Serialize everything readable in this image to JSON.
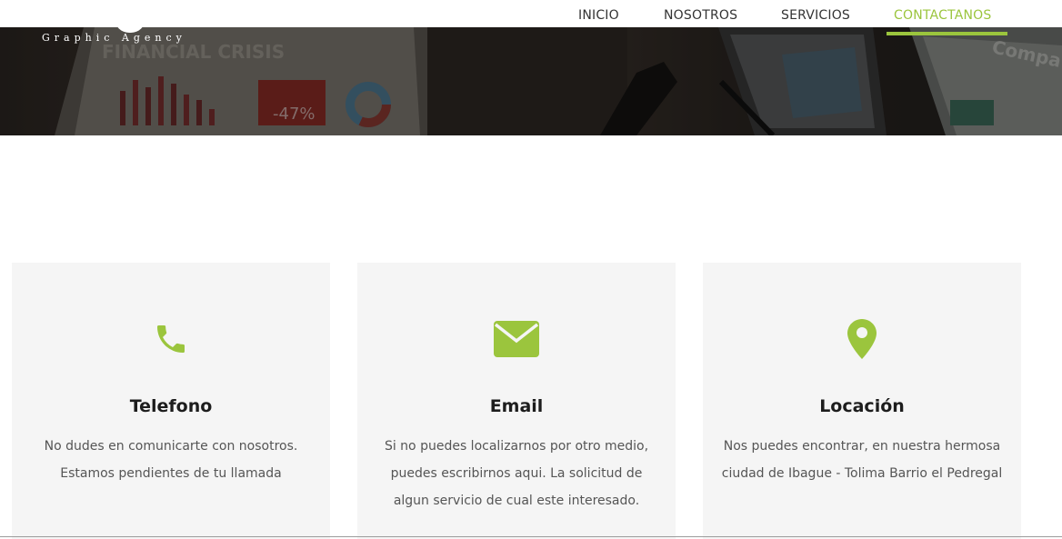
{
  "brand": {
    "tagline": "Graphic Agency"
  },
  "nav": {
    "items": [
      {
        "label": "INICIO"
      },
      {
        "label": "NOSOTROS"
      },
      {
        "label": "SERVICIOS"
      },
      {
        "label": "CONTACTANOS"
      }
    ],
    "active": "CONTACTANOS",
    "accent_color": "#9bc53d"
  },
  "hero": {
    "headline_text": "FINANCIAL CRISIS",
    "stat_text": "-47%",
    "corner_text": "Compa"
  },
  "cards": [
    {
      "icon": "phone-icon",
      "title": "Telefono",
      "text": "No dudes en comunicarte con nosotros. Estamos pendientes de tu llamada"
    },
    {
      "icon": "envelope-icon",
      "title": "Email",
      "text": "Si no puedes localizarnos por otro medio, puedes escribirnos aqui. La solicitud de algun servicio de cual este interesado."
    },
    {
      "icon": "map-pin-icon",
      "title": "Locación",
      "text": "Nos puedes encontrar, en nuestra hermosa ciudad de Ibague - Tolima Barrio el Pedregal"
    }
  ],
  "colors": {
    "accent": "#9bc53d",
    "card_background": "#f5f5f5",
    "heading": "#1d1d1d",
    "body_text": "#555555"
  }
}
